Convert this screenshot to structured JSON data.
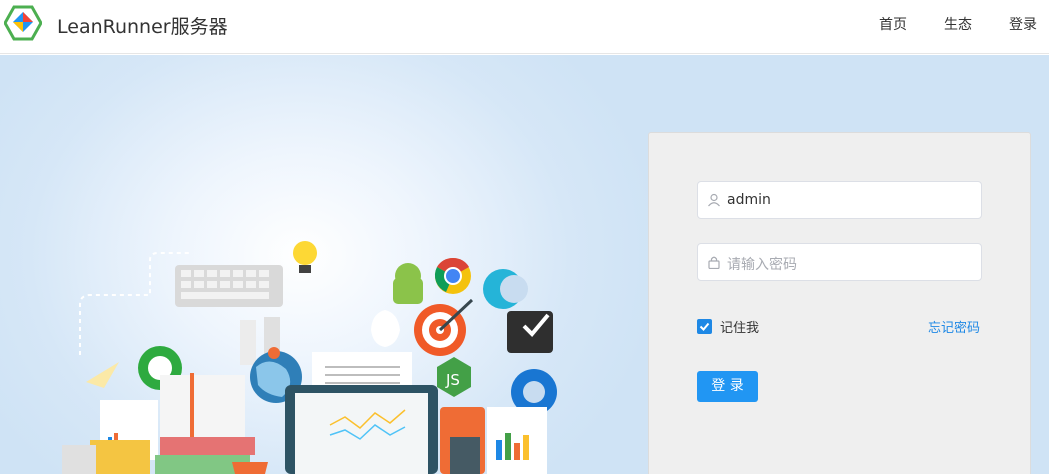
{
  "header": {
    "title": "LeanRunner服务器",
    "nav": [
      "首页",
      "生态",
      "登录"
    ]
  },
  "login": {
    "username_value": "admin",
    "password_placeholder": "请输入密码",
    "remember_label": "记住我",
    "remember_checked": true,
    "forgot_label": "忘记密码",
    "submit_label": "登 录"
  },
  "colors": {
    "accent": "#2196f3",
    "link": "#1e88e5"
  },
  "icons": [
    "leanrunner-logo",
    "user-icon",
    "lock-icon",
    "checkbox-checked-icon"
  ]
}
